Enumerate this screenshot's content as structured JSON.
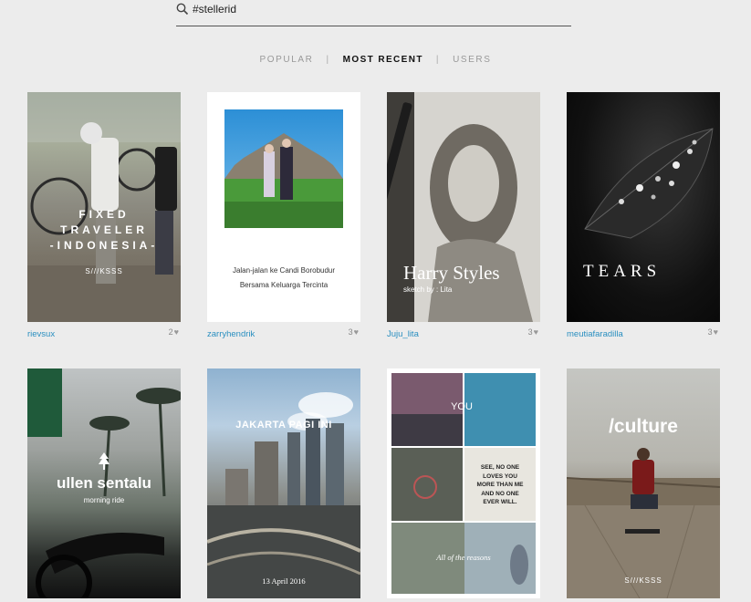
{
  "search": {
    "query": "#stellerid"
  },
  "tabs": [
    {
      "label": "POPULAR",
      "active": false
    },
    {
      "label": "MOST RECENT",
      "active": true
    },
    {
      "label": "USERS",
      "active": false
    }
  ],
  "cards": [
    {
      "user": "rievsux",
      "likes": "2",
      "lines": [
        "FIXED",
        "TRAVELER",
        "-INDONESIA-"
      ],
      "sub": "S///KSSS"
    },
    {
      "user": "zarryhendrik",
      "likes": "3",
      "lines": [
        "Jalan-jalan ke Candi Borobudur",
        "Bersama Keluarga Tercinta"
      ]
    },
    {
      "user": "Juju_lita",
      "likes": "3",
      "title": "Harry Styles",
      "sub": "sketch by : Lita"
    },
    {
      "user": "meutiafaradilla",
      "likes": "3",
      "title": "TEARS"
    },
    {
      "user": "",
      "likes": "",
      "title": "ullen sentalu",
      "sub": "morning ride"
    },
    {
      "user": "",
      "likes": "",
      "title": "JAKARTA PAGI INI",
      "sub": "13 April 2016"
    },
    {
      "user": "",
      "likes": "",
      "tl": "YOU",
      "quote": [
        "SEE, NO ONE",
        "LOVES YOU",
        "MORE THAN ME",
        "AND NO ONE",
        "EVER WILL."
      ],
      "sub": "All of the reasons"
    },
    {
      "user": "",
      "likes": "",
      "title": "/culture",
      "sub": "S///KSSS"
    }
  ],
  "colors": {
    "username": "#2a8fc0",
    "background": "#ececec"
  }
}
